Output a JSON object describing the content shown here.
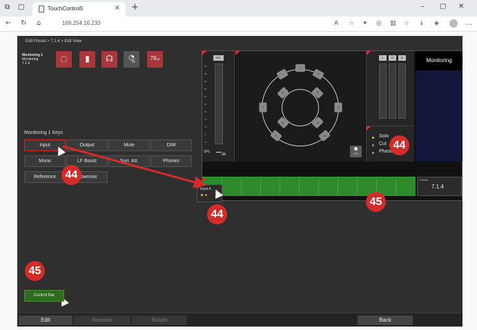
{
  "browser": {
    "tab_title": "TouchControl5",
    "tab_close": "×",
    "new_tab": "+",
    "url": "169.254.16.233",
    "icons": [
      "tab-actions-icon",
      "workspaces-icon",
      "back-icon",
      "refresh-icon",
      "home-icon",
      "read-aloud-icon",
      "favorite-icon",
      "extensions-icon",
      "collections-icon",
      "split-screen-icon",
      "favorites-bar-icon",
      "downloads-icon",
      "copilot-icon",
      "profile-icon",
      "more-icon"
    ]
  },
  "app": {
    "breadcrumb": "Edit Preset > 7.1.4 > Edit View",
    "monitor_title": "Monitoring 1",
    "monitor_subtitle": "Monitoring",
    "monitor_format": "7.1.4",
    "tile_78_label": "78",
    "tile_78_unit": "dB",
    "tile_70_label": "70",
    "keys_title": "Monitoring 1 Keys",
    "keys": [
      "Input",
      "Output",
      "Mute",
      "DIM",
      "Mono",
      "LF Boost",
      "Surr. Att.",
      "Phones",
      "Reference",
      "Downmix"
    ],
    "display": {
      "spl_tag": "SPL",
      "spl_ticks": [
        "90",
        "88",
        "86",
        "84",
        "82",
        "80",
        "78",
        "76",
        "74",
        "72",
        "70"
      ],
      "spl_value": "SPL",
      "spl_unit": "dB",
      "lrm_tags": [
        "L",
        "R",
        "M"
      ],
      "lfe_label": "LFE",
      "speakers": [
        "C",
        "L",
        "R",
        "Ls",
        "Rs",
        "Lb",
        "Rb",
        "Tfl",
        "Tfr",
        "Tbl",
        "Tbr"
      ],
      "controls": [
        {
          "label": "Solo",
          "active": true
        },
        {
          "label": "Cut",
          "active": false
        },
        {
          "label": "Phase",
          "active": false
        }
      ],
      "monitor_panel_title": "Monitoring",
      "preset_label": "Preset",
      "preset_value": "7.1.4",
      "input_a_label": "Input A"
    },
    "annotations": {
      "badge_44": "44",
      "badge_45": "45"
    },
    "control_bar_label": "Control Bar",
    "bottom_buttons": [
      {
        "label": "Edit",
        "enabled": true
      },
      {
        "label": "Remove",
        "enabled": false
      },
      {
        "label": "Rotate",
        "enabled": false
      },
      {
        "label": "Back",
        "enabled": true
      }
    ]
  },
  "colors": {
    "tile_red": "#a9363a",
    "annotation_red": "#d42b2b",
    "control_bar_green": "#2e8a2a",
    "solo_dot": "#f2d32e"
  }
}
